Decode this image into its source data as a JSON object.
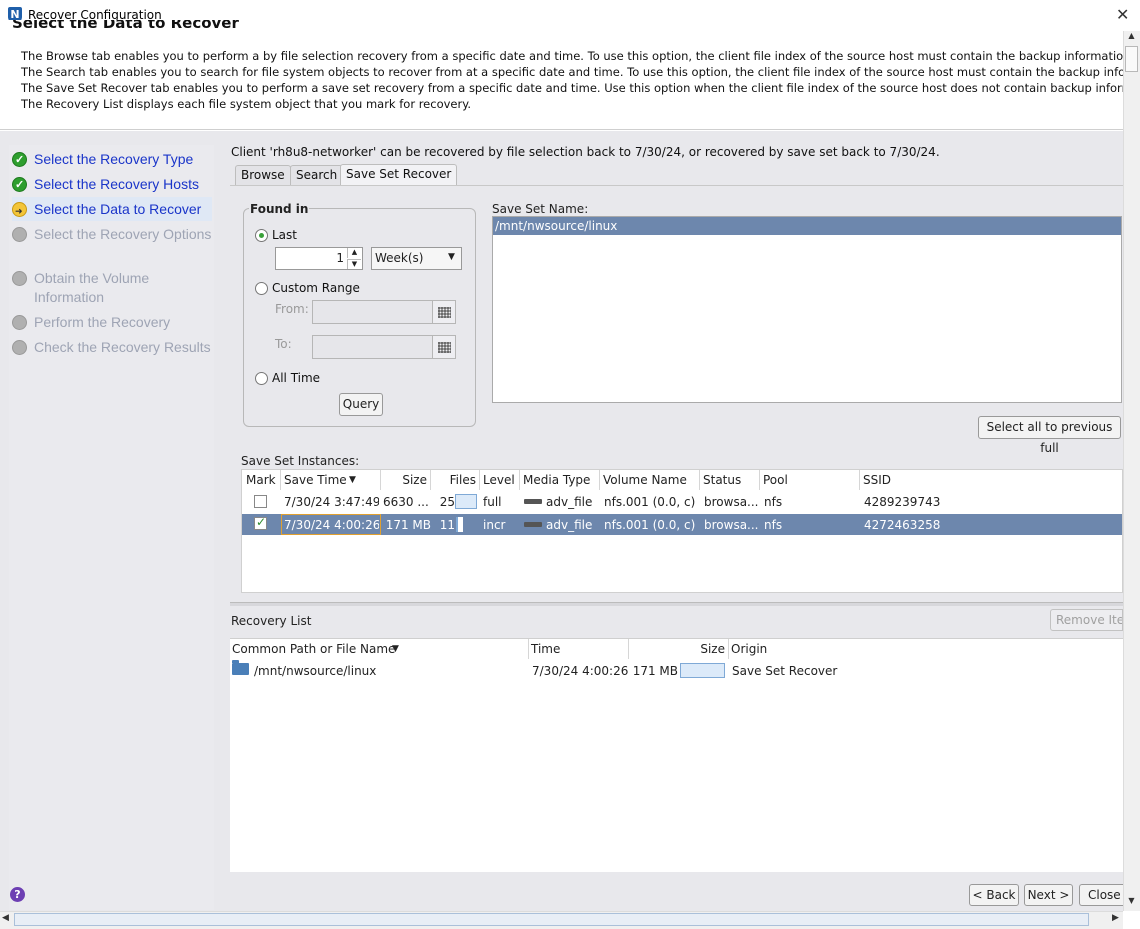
{
  "window": {
    "title": "Recover Configuration",
    "app_icon_letter": "N"
  },
  "header": {
    "title": "Select the Data to Recover",
    "lines": [
      "The Browse tab enables you to perform a by file selection recovery from a specific date and time. To use this option, the client file index of the source host must contain the backup information.",
      "The Search tab enables you to search for file system objects to recover from at a specific date and time. To use this option, the client file index of the source host must contain the backup information.",
      "The Save Set Recover tab enables you to perform a save set recovery from a specific date and time.  Use this option when the client file index of the source host does not contain backup information.",
      "The Recovery List displays each file system object that you mark for recovery."
    ]
  },
  "steps": [
    {
      "label": "Select the Recovery Type",
      "state": "done"
    },
    {
      "label": "Select the Recovery Hosts",
      "state": "done"
    },
    {
      "label": "Select the Data to Recover",
      "state": "current"
    },
    {
      "label": "Select the Recovery Options",
      "state": "pending"
    },
    {
      "label": "Obtain the Volume Information",
      "state": "pending"
    },
    {
      "label": "Perform the Recovery",
      "state": "pending"
    },
    {
      "label": "Check the Recovery Results",
      "state": "pending"
    }
  ],
  "client_info": "Client 'rh8u8-networker' can be recovered by file selection back to 7/30/24, or recovered by save set back to 7/30/24.",
  "tabs": [
    {
      "label": "Browse"
    },
    {
      "label": "Search"
    },
    {
      "label": "Save Set Recover",
      "active": true
    }
  ],
  "found_in": {
    "title": "Found in",
    "last_label": "Last",
    "last_value": "1",
    "unit": "Week(s)",
    "custom_label": "Custom Range",
    "from_label": "From:",
    "to_label": "To:",
    "all_label": "All Time",
    "selected": "last",
    "query_label": "Query"
  },
  "save_set_name": {
    "label": "Save Set Name:",
    "items": [
      "/mnt/nwsource/linux"
    ]
  },
  "select_all_label": "Select all to previous full",
  "instances": {
    "label": "Save Set Instances:",
    "columns": [
      "Mark",
      "Save Time",
      "Size",
      "Files",
      "Level",
      "Media Type",
      "Volume Name",
      "Status",
      "Pool",
      "SSID"
    ],
    "rows": [
      {
        "mark": false,
        "save_time": "7/30/24 3:47:49...",
        "size": "6630 ...",
        "files": "25",
        "level": "full",
        "media": "adv_file",
        "volume": "nfs.001 (0.0, c)",
        "status": "browsa...",
        "pool": "nfs",
        "ssid": "4289239743"
      },
      {
        "mark": true,
        "save_time": "7/30/24 4:00:26...",
        "size": "171 MB",
        "files": "11",
        "level": "incr",
        "media": "adv_file",
        "volume": "nfs.001 (0.0, c)",
        "status": "browsa...",
        "pool": "nfs",
        "ssid": "4272463258"
      }
    ]
  },
  "recovery_list": {
    "label": "Recovery List",
    "remove_label": "Remove Item",
    "columns": [
      "Common Path or File Name",
      "Time",
      "Size",
      "Origin"
    ],
    "rows": [
      {
        "path": "/mnt/nwsource/linux",
        "time": "7/30/24 4:00:26...",
        "size": "171 MB",
        "origin": "Save Set Recover"
      }
    ]
  },
  "buttons": {
    "back": "< Back",
    "next": "Next >",
    "close": "Close"
  },
  "colors": {
    "selection": "#6d87ad",
    "link": "#1a35c9",
    "done": "#2e9e2e",
    "current": "#f3c53a"
  }
}
